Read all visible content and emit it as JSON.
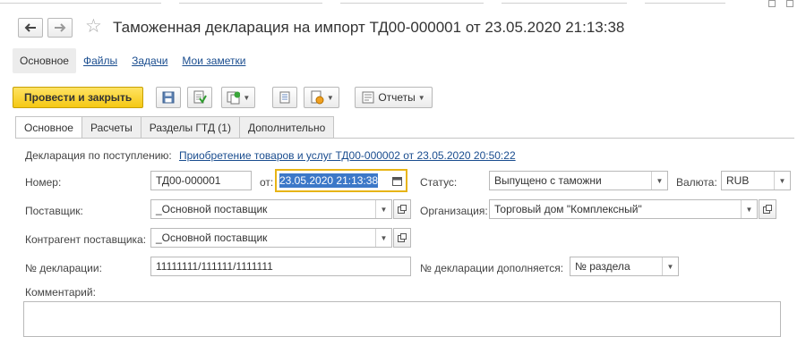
{
  "window": {
    "title": "Таможенная декларация на импорт ТД00-000001 от 23.05.2020 21:13:38"
  },
  "sections": [
    {
      "label": "Основное"
    },
    {
      "label": "Файлы"
    },
    {
      "label": "Задачи"
    },
    {
      "label": "Мои заметки"
    }
  ],
  "toolbar": {
    "post_close_label": "Провести и закрыть",
    "reports_label": "Отчеты"
  },
  "tabs": [
    {
      "label": "Основное"
    },
    {
      "label": "Расчеты"
    },
    {
      "label": "Разделы ГТД (1)"
    },
    {
      "label": "Дополнительно"
    }
  ],
  "form": {
    "receipt_label": "Декларация по поступлению:",
    "receipt_link": "Приобретение товаров и услуг ТД00-000002 от 23.05.2020 20:50:22",
    "number_label": "Номер:",
    "number_value": "ТД00-000001",
    "date_label": "от:",
    "date_value": "23.05.2020 21:13:38",
    "status_label": "Статус:",
    "status_value": "Выпущено с таможни",
    "currency_label": "Валюта:",
    "currency_value": "RUB",
    "supplier_label": "Поставщик:",
    "supplier_value": "_Основной поставщик",
    "organization_label": "Организация:",
    "organization_value": "Торговый дом \"Комплексный\"",
    "contractor_label": "Контрагент поставщика:",
    "contractor_value": "_Основной поставщик",
    "declaration_no_label": "№ декларации:",
    "declaration_no_value": "11111111/111111/1111111",
    "declaration_supp_label": "№ декларации дополняется:",
    "declaration_supp_value": "№ раздела",
    "comment_label": "Комментарий:"
  }
}
